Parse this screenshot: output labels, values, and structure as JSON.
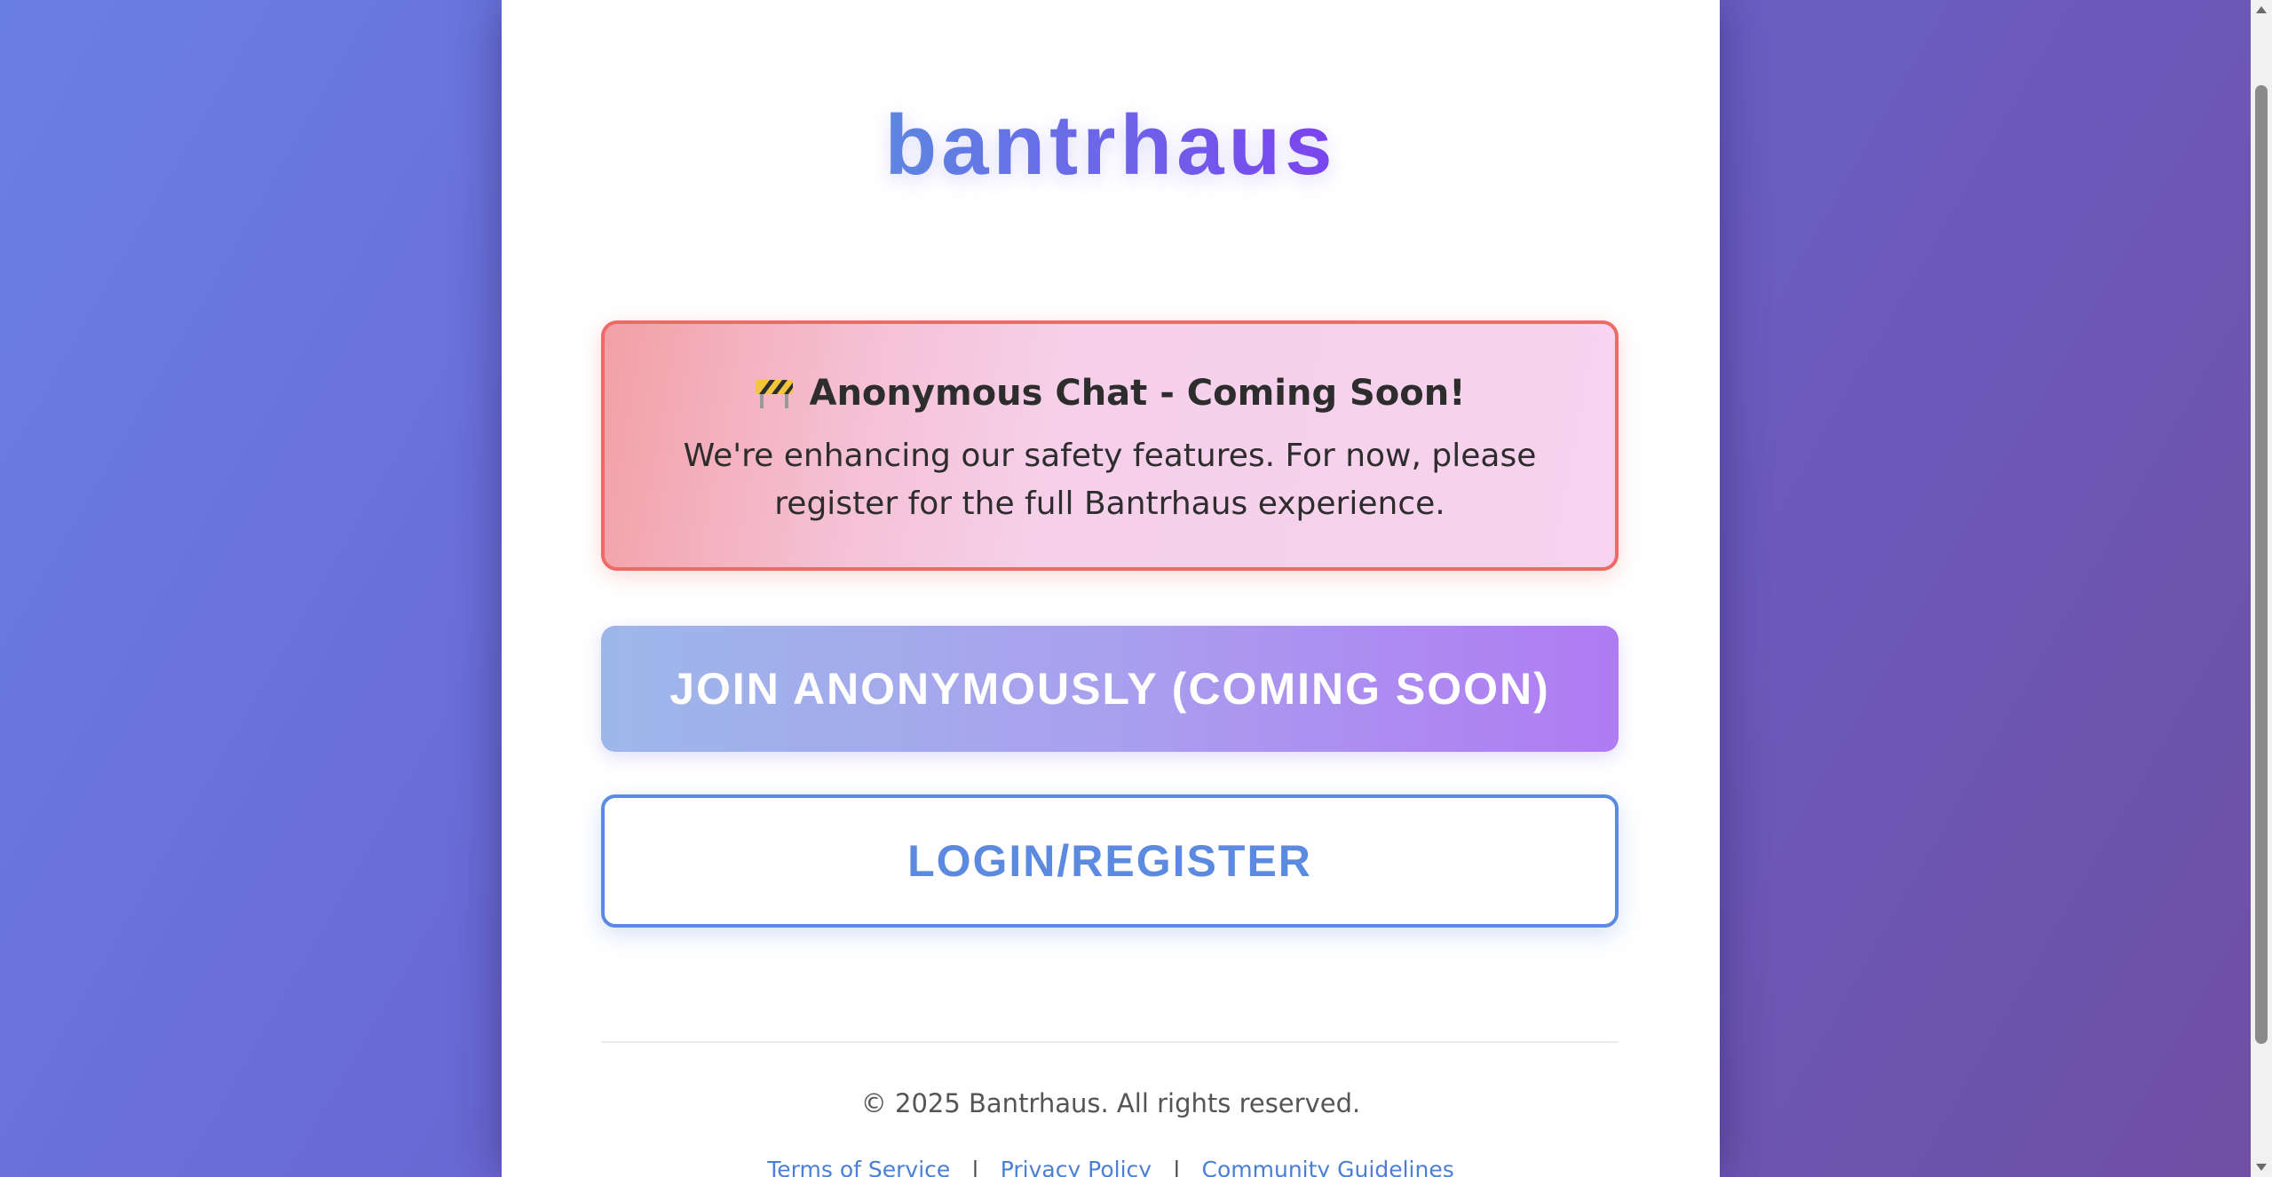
{
  "logo": {
    "text": "bantrhaus"
  },
  "notice": {
    "icon": "construction-barrier-icon",
    "title": "Anonymous Chat - Coming Soon!",
    "body": "We're enhancing our safety features. For now, please register for the full Bantrhaus experience."
  },
  "buttons": {
    "anonymous_label": "JOIN ANONYMOUSLY (COMING SOON)",
    "login_label": "LOGIN/REGISTER"
  },
  "footer": {
    "copyright": "© 2025 Bantrhaus. All rights reserved.",
    "links": [
      {
        "label": "Terms of Service"
      },
      {
        "label": "Privacy Policy"
      },
      {
        "label": "Community Guidelines"
      }
    ],
    "separator": "|"
  },
  "colors": {
    "brand_blue": "#5b8ae0",
    "brand_purple": "#7d3ff0",
    "notice_border": "#ee6a66"
  }
}
